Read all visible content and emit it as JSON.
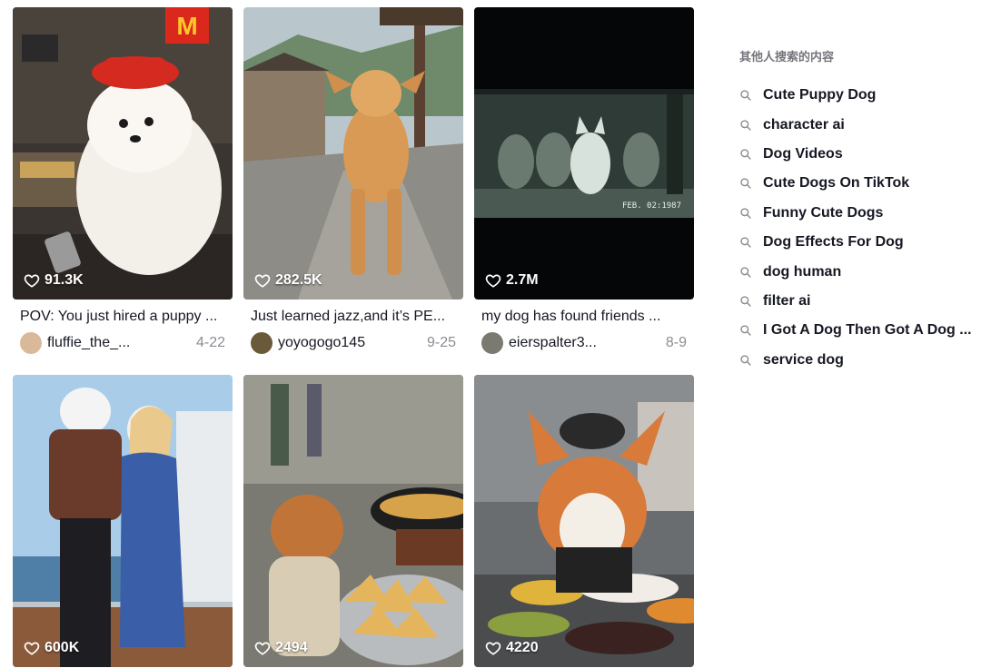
{
  "videos": [
    {
      "likes": "91.3K",
      "description": "POV: You just hired a puppy ...",
      "username": "fluffie_the_...",
      "date": "4-22",
      "avatar_color": "#d9b99a"
    },
    {
      "likes": "282.5K",
      "description": "Just learned jazz,and it’s PE...",
      "username": "yoyogogo145",
      "date": "9-25",
      "avatar_color": "#6b5a3a"
    },
    {
      "likes": "2.7M",
      "description": "my dog has found friends ...",
      "username": "eierspalter3...",
      "date": "8-9",
      "avatar_color": "#7a7a70"
    },
    {
      "likes": "600K",
      "description": "",
      "username": "",
      "date": "",
      "avatar_color": ""
    },
    {
      "likes": "2494",
      "description": "",
      "username": "",
      "date": "",
      "avatar_color": ""
    },
    {
      "likes": "4220",
      "description": "",
      "username": "",
      "date": "",
      "avatar_color": ""
    }
  ],
  "video3_overlay": "FEB. 02:1987",
  "video1_logo": "M",
  "sidebar": {
    "heading": "其他人搜索的内容",
    "suggestions": [
      "Cute Puppy Dog",
      "character ai",
      "Dog Videos",
      "Cute Dogs On TikTok",
      "Funny Cute Dogs",
      "Dog Effects For Dog",
      "dog human",
      "filter ai",
      "I Got A Dog Then Got A Dog ...",
      "service dog"
    ]
  },
  "colors": {
    "text": "#161823",
    "muted": "rgba(22,24,35,0.5)",
    "mcd_red": "#da291c",
    "mcd_yellow": "#ffc72c"
  },
  "icons": {
    "likes": "heart-outline-icon",
    "suggestion": "search-icon"
  }
}
